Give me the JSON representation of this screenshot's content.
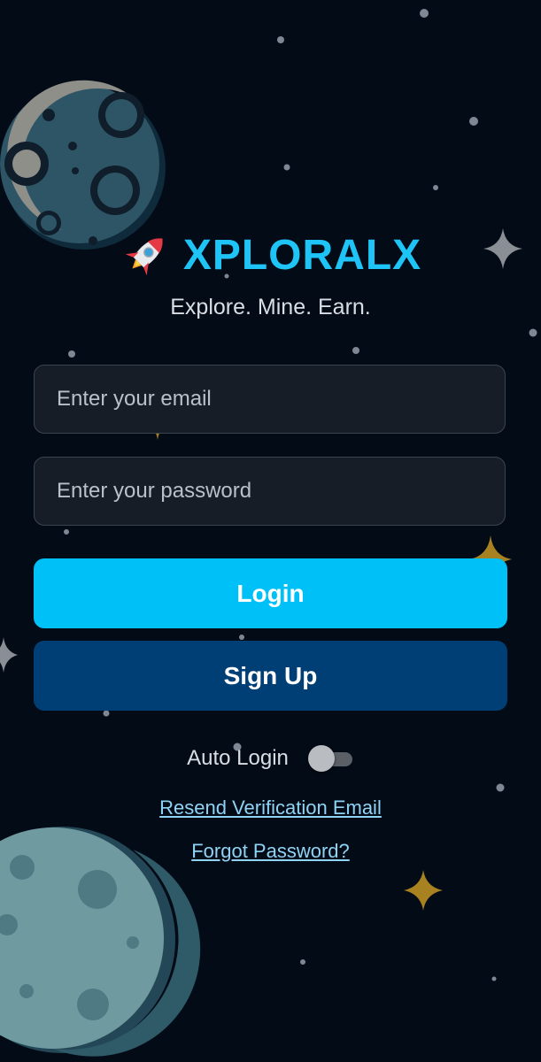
{
  "brand": {
    "title": "XPLORALX",
    "tagline": "Explore. Mine. Earn.",
    "rocket_icon": "rocket-icon",
    "accent_color": "#1fc4f7"
  },
  "form": {
    "email_placeholder": "Enter your email",
    "email_value": "",
    "password_placeholder": "Enter your password",
    "password_value": ""
  },
  "buttons": {
    "login_label": "Login",
    "login_color": "#00c1f7",
    "signup_label": "Sign Up",
    "signup_color": "#003f75"
  },
  "auto_login": {
    "label": "Auto Login",
    "enabled": false
  },
  "links": {
    "resend_verification": "Resend Verification Email",
    "forgot_password": "Forgot Password?"
  },
  "background": {
    "color": "#030b16",
    "decorations": [
      "moon-icon",
      "planet-icon",
      "star-icon"
    ]
  }
}
